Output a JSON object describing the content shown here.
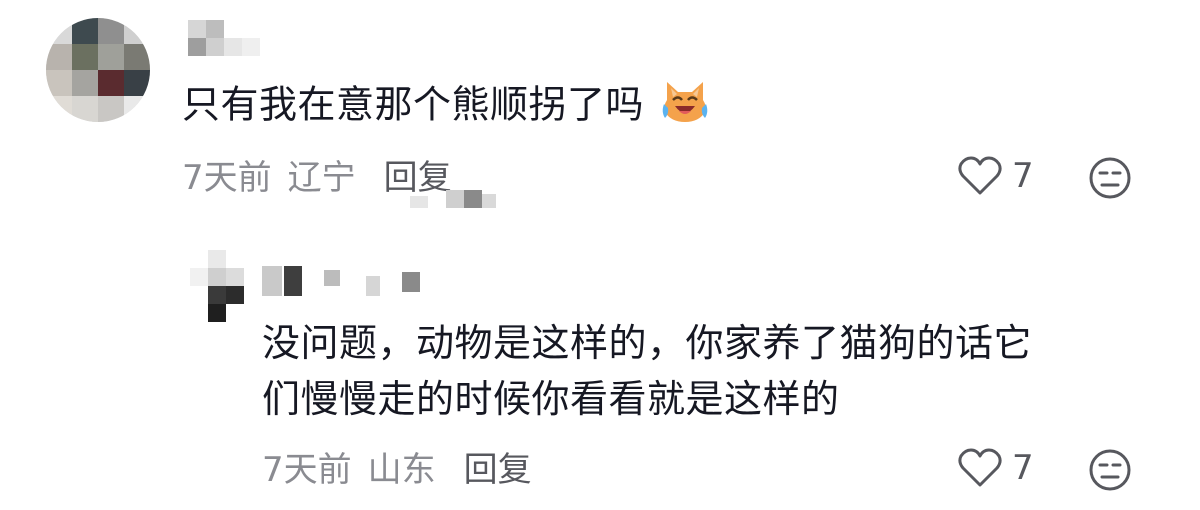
{
  "comments": [
    {
      "text": "只有我在意那个熊顺拐了吗",
      "emoji": "laughing-crying-cat-emoji",
      "time": "7天前",
      "location": "辽宁",
      "reply_label": "回复",
      "likes": "7"
    },
    {
      "text_line1": "没问题，动物是这样的，你家养了猫狗的话它",
      "text_line2": "们慢慢走的时候你看看就是这样的",
      "time": "7天前",
      "location": "山东",
      "reply_label": "回复",
      "likes": "7"
    }
  ],
  "colors": {
    "text": "#161823",
    "meta": "#8a8b91",
    "reply": "#57585e",
    "icon": "#57585e"
  }
}
